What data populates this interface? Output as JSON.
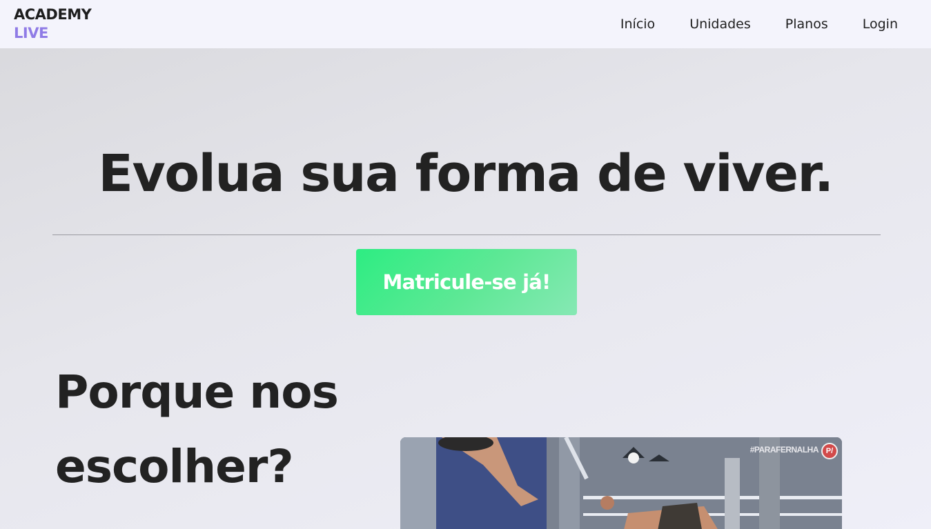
{
  "header": {
    "logo_top": "ACADEMY",
    "logo_bottom": "LIVE",
    "nav": [
      "Início",
      "Unidades",
      "Planos",
      "Login"
    ]
  },
  "hero": {
    "title": "Evolua sua forma de viver.",
    "cta_label": "Matricule-se já!"
  },
  "why": {
    "title": "Porque nos escolher?"
  },
  "video": {
    "watermark": "#PARAFERNALHA",
    "badge": "P/"
  },
  "colors": {
    "logo_accent": "#8f7be6",
    "cta_gradient_start": "#2ded82",
    "cta_gradient_end": "#86e8b4",
    "text": "#222222"
  }
}
